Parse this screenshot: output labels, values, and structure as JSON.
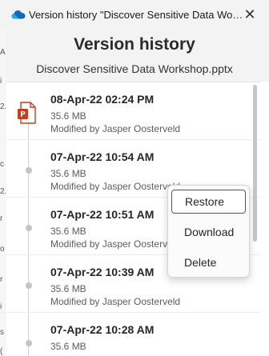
{
  "window": {
    "title": "Version history \"Discover Sensitive Data Works...",
    "close_glyph": "✕"
  },
  "peek_glyphs": [
    "A",
    "i",
    "2.",
    "c",
    "2.",
    "r",
    "o",
    "r",
    "i",
    "s",
    "("
  ],
  "dialog": {
    "heading": "Version history",
    "filename": "Discover Sensitive Data Workshop.pptx"
  },
  "versions": [
    {
      "date": "08-Apr-22 02:24 PM",
      "size": "35.6 MB",
      "author": "Modified by Jasper Oosterveld",
      "icon": "powerpoint-icon"
    },
    {
      "date": "07-Apr-22 10:54 AM",
      "size": "35.6 MB",
      "author": "Modified by Jasper Oosterveld",
      "icon": "timeline-dot-icon"
    },
    {
      "date": "07-Apr-22 10:51 AM",
      "size": "35.6 MB",
      "author": "Modified by Jasper Oosterveld",
      "icon": "timeline-dot-icon"
    },
    {
      "date": "07-Apr-22 10:39 AM",
      "size": "35.6 MB",
      "author": "Modified by Jasper Oosterveld",
      "icon": "timeline-dot-icon"
    },
    {
      "date": "07-Apr-22 10:28 AM",
      "size": "35.6 MB",
      "author": "",
      "icon": "timeline-dot-icon"
    }
  ],
  "context_menu": {
    "items": [
      "Restore",
      "Download",
      "Delete"
    ],
    "focused_item": "Restore"
  },
  "colors": {
    "onedrive_blue": "#0f6cbd",
    "powerpoint_red": "#c43e1c",
    "titlebar_bg": "#f3f3f3"
  }
}
